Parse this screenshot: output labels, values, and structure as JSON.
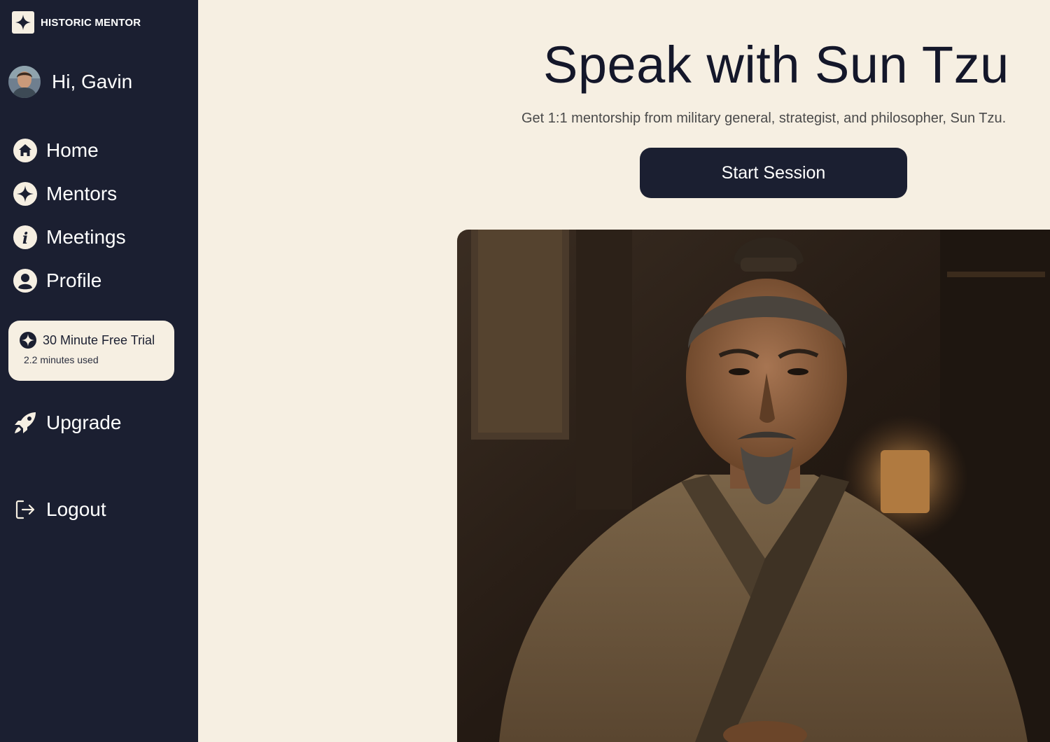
{
  "brand": {
    "name": "HISTORIC MENTOR",
    "logo_icon": "four-point-star-icon"
  },
  "user": {
    "greeting": "Hi, Gavin",
    "avatar_icon": "user-avatar"
  },
  "nav": {
    "items": [
      {
        "label": "Home",
        "icon": "home-icon"
      },
      {
        "label": "Mentors",
        "icon": "star-icon"
      },
      {
        "label": "Meetings",
        "icon": "info-icon"
      },
      {
        "label": "Profile",
        "icon": "user-icon"
      }
    ]
  },
  "trial": {
    "title": "30 Minute Free Trial",
    "usage": "2.2  minutes used"
  },
  "upgrade": {
    "label": "Upgrade",
    "icon": "rocket-icon"
  },
  "logout": {
    "label": "Logout",
    "icon": "logout-icon"
  },
  "main": {
    "headline": "Speak with Sun Tzu",
    "subline": "Get 1:1 mentorship from military general, strategist, and philosopher, Sun Tzu.",
    "cta_label": "Start Session"
  },
  "colors": {
    "sidebar_bg": "#1b1f31",
    "page_bg": "#f6efe2",
    "button_bg": "#1b1f31"
  }
}
